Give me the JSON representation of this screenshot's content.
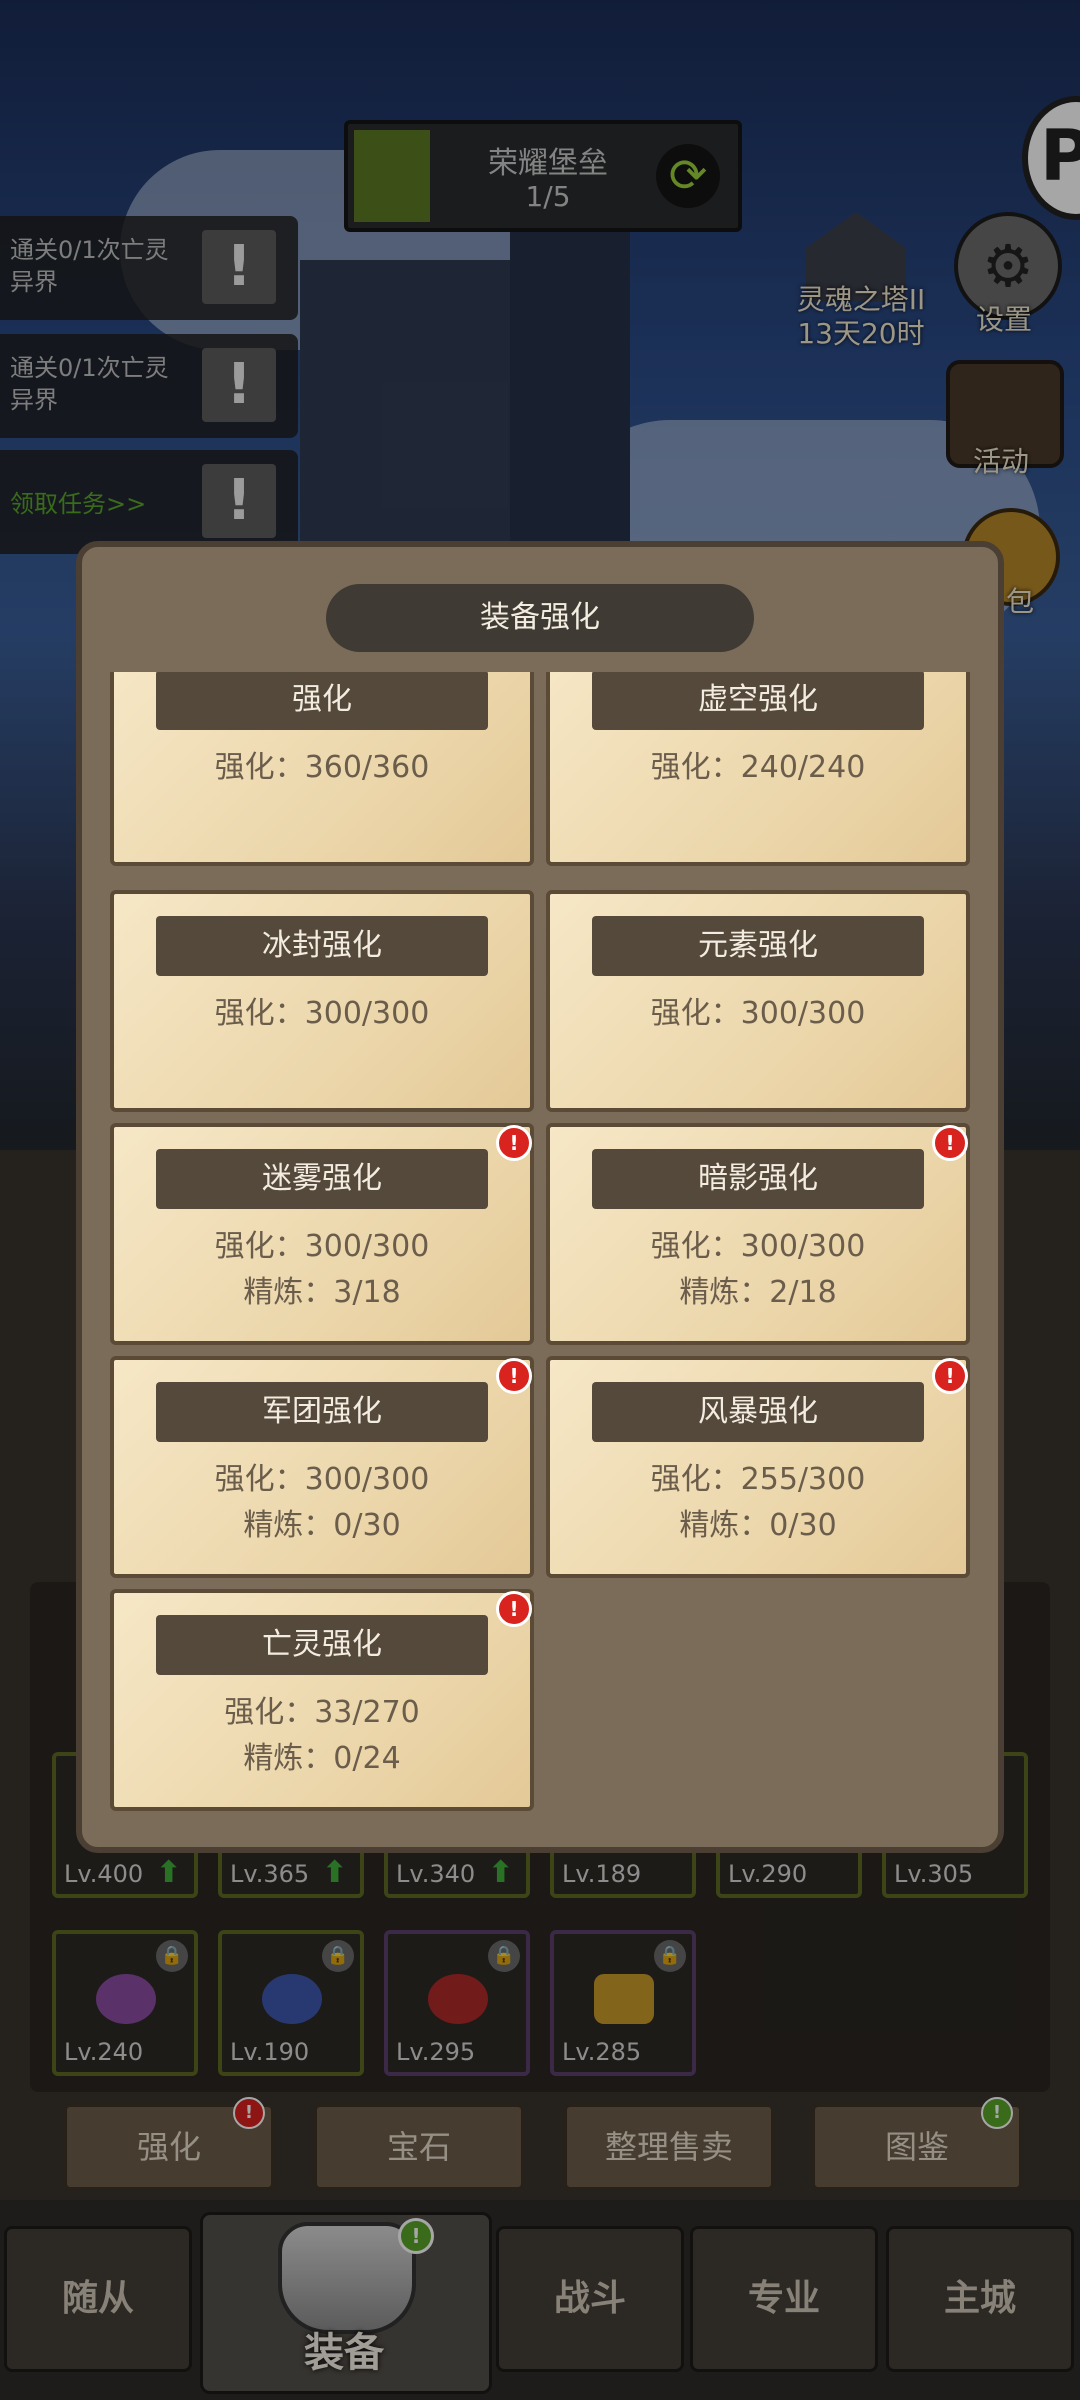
{
  "top_bar": {
    "title": "荣耀堡垒",
    "progress_text": "1/5",
    "progress_fraction": 0.2,
    "refresh_icon": "refresh-icon"
  },
  "quests": [
    {
      "text": "通关0/1次亡灵异界"
    },
    {
      "text": "通关0/1次亡灵异界"
    },
    {
      "link": "领取任务>>"
    }
  ],
  "side_menu": {
    "tower_label": "灵魂之塔II",
    "tower_timer": "13天20时",
    "settings_label": "设置",
    "activity_label": "活动",
    "bag_label": "包"
  },
  "modal": {
    "title": "装备强化",
    "cards": [
      {
        "name": "强化",
        "enhance": "强化：360/360",
        "refine": "",
        "alert": false
      },
      {
        "name": "虚空强化",
        "enhance": "强化：240/240",
        "refine": "",
        "alert": false
      },
      {
        "name": "冰封强化",
        "enhance": "强化：300/300",
        "refine": "",
        "alert": false
      },
      {
        "name": "元素强化",
        "enhance": "强化：300/300",
        "refine": "",
        "alert": false
      },
      {
        "name": "迷雾强化",
        "enhance": "强化：300/300",
        "refine": "精炼：3/18",
        "alert": true
      },
      {
        "name": "暗影强化",
        "enhance": "强化：300/300",
        "refine": "精炼：2/18",
        "alert": true
      },
      {
        "name": "军团强化",
        "enhance": "强化：300/300",
        "refine": "精炼：0/30",
        "alert": true
      },
      {
        "name": "风暴强化",
        "enhance": "强化：255/300",
        "refine": "精炼：0/30",
        "alert": true
      },
      {
        "name": "亡灵强化",
        "enhance": "强化：33/270",
        "refine": "精炼：0/24",
        "alert": true
      }
    ]
  },
  "equipment_row1": [
    {
      "level": "Lv.400",
      "upgrade": true
    },
    {
      "level": "Lv.365",
      "upgrade": true
    },
    {
      "level": "Lv.340",
      "upgrade": true
    },
    {
      "level": "Lv.189",
      "upgrade": false
    },
    {
      "level": "Lv.290",
      "upgrade": false
    },
    {
      "level": "Lv.305",
      "upgrade": false
    }
  ],
  "equipment_row2": [
    {
      "level": "Lv.240",
      "locked": true
    },
    {
      "level": "Lv.190",
      "locked": true
    },
    {
      "level": "Lv.295",
      "locked": true
    },
    {
      "level": "Lv.285",
      "locked": true
    }
  ],
  "actions": [
    {
      "label": "强化",
      "badge": "!",
      "badge_color": "#d9231f"
    },
    {
      "label": "宝石"
    },
    {
      "label": "整理售卖"
    },
    {
      "label": "图鉴",
      "badge": "!",
      "badge_color": "#5aa52a"
    }
  ],
  "nav": {
    "followers": "随从",
    "equipment": "装备",
    "battle": "战斗",
    "profession": "专业",
    "main_city": "主城",
    "equipment_badge": "!"
  }
}
